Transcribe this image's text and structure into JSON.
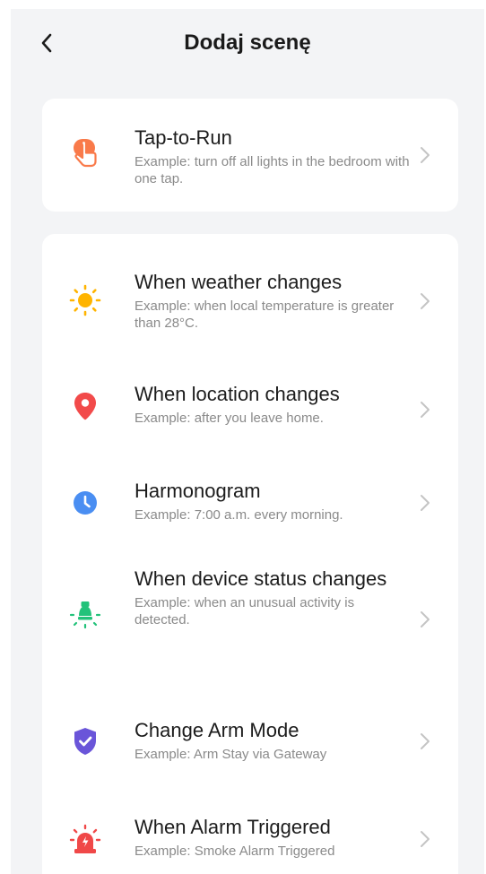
{
  "header": {
    "back_label": "<",
    "title": "Dodaj scenę"
  },
  "tap_to_run": {
    "title": "Tap-to-Run",
    "description": "Example: turn off all lights in the bedroom with one tap.",
    "icon": "hand-tap-icon",
    "color": "#f97a4a"
  },
  "automations": [
    {
      "title": "When weather changes",
      "description": "Example: when local temperature is greater than 28°C.",
      "icon": "sun-icon",
      "color": "#ffb400"
    },
    {
      "title": "When location changes",
      "description": "Example: after you leave home.",
      "icon": "location-pin-icon",
      "color": "#f24a4a"
    },
    {
      "title": "Harmonogram",
      "description": "Example: 7:00 a.m. every morning.",
      "icon": "clock-icon",
      "color": "#4a8ef2"
    },
    {
      "title": "When device status changes",
      "description": "Example: when an unusual activity is detected.",
      "icon": "device-bulb-icon",
      "color": "#22c27a"
    },
    {
      "title": "Change Arm Mode",
      "description": "Example: Arm Stay via Gateway",
      "icon": "shield-check-icon",
      "color": "#6a55d9"
    },
    {
      "title": "When Alarm Triggered",
      "description": "Example: Smoke Alarm Triggered",
      "icon": "alarm-siren-icon",
      "color": "#f04848"
    }
  ]
}
